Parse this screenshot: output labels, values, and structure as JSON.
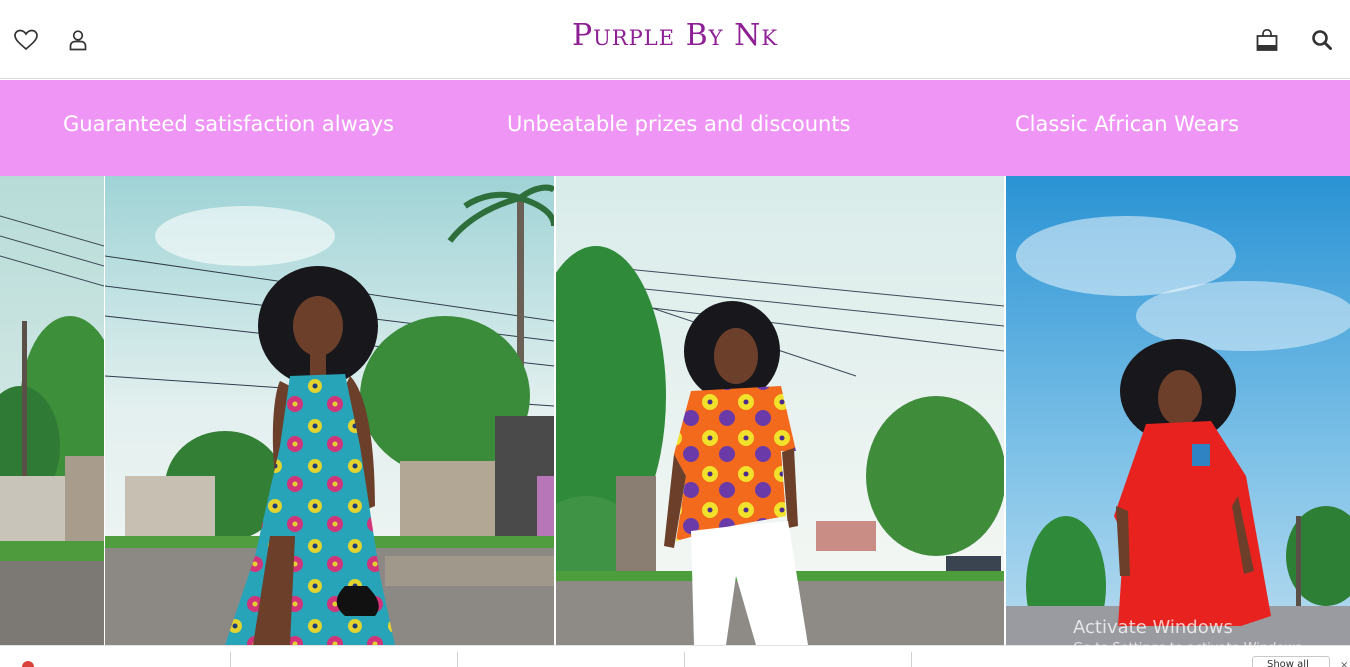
{
  "header": {
    "brand": "Purple By Nk",
    "icons": {
      "wishlist": "heart-icon",
      "account": "user-icon",
      "cart": "shopping-bag-icon",
      "search": "search-icon"
    }
  },
  "banner": {
    "items": [
      "Guaranteed satisfaction always",
      "Unbeatable prizes and discounts",
      "Classic African Wears"
    ]
  },
  "gallery": {
    "slides": [
      {
        "description_icon": "photo-street-partial"
      },
      {
        "description_icon": "photo-model-blue-dress"
      },
      {
        "description_icon": "photo-model-orange-top"
      },
      {
        "description_icon": "photo-model-red-dress"
      }
    ]
  },
  "bottom_bar": {
    "button_label": "Show all"
  },
  "watermark": {
    "title": "Activate Windows",
    "subtitle": "Go to Settings to activate Windows."
  },
  "colors": {
    "brand": "#8e1f95",
    "banner": "#ef95f5",
    "banner_text": "#ffffff",
    "icon": "#333333"
  }
}
